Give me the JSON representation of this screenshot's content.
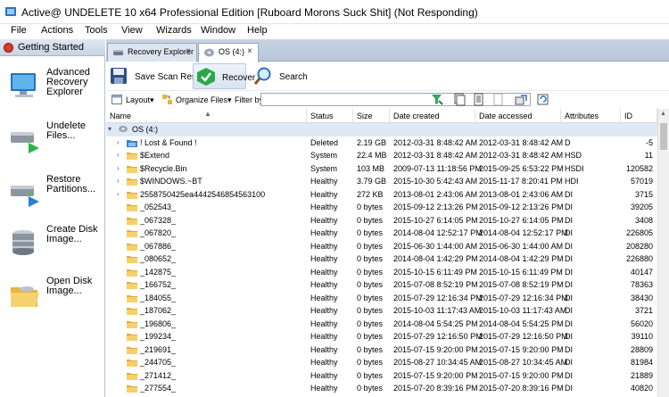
{
  "window": {
    "title": "Active@ UNDELETE 10 x64 Professional Edition [Ruboard Morons Suck Shit] (Not Responding)"
  },
  "menu": [
    "File",
    "Actions",
    "Tools",
    "View",
    "Wizards",
    "Window",
    "Help"
  ],
  "left_panel": {
    "header": "Getting Started",
    "items": [
      {
        "label": "Advanced\nRecovery\nExplorer",
        "icon": "computer-icon"
      },
      {
        "label": "Undelete\nFiles...",
        "icon": "disk-undelete-icon"
      },
      {
        "label": "Restore\nPartitions...",
        "icon": "disk-restore-icon"
      },
      {
        "label": "Create Disk\nImage...",
        "icon": "disk-stack-icon"
      },
      {
        "label": "Open Disk\nImage...",
        "icon": "open-folder-icon"
      }
    ]
  },
  "tabs": [
    {
      "label": "Recovery Explorer",
      "icon": "drive-icon",
      "close": "×"
    },
    {
      "label": "OS (4:)",
      "icon": "disk-icon",
      "close": "×"
    }
  ],
  "toolbar": {
    "save_scan": "Save Scan Results",
    "recover": "Recover",
    "search": "Search"
  },
  "filterbar": {
    "layout": "Layout▾",
    "organize": "Organize Files▾",
    "filter_by": "Filter by:",
    "filter_value": ""
  },
  "columns": [
    "Name",
    "Status",
    "Size",
    "Date created",
    "Date accessed",
    "Attributes",
    "ID"
  ],
  "drive_row": {
    "name": "OS (4:)"
  },
  "rows": [
    {
      "name": "! Lost & Found !",
      "status": "Deleted",
      "size": "2.19 GB",
      "created": "2012-03-31 8:48:42 AM",
      "accessed": "2012-03-31 8:48:42 AM",
      "attr": "D",
      "id": "-5",
      "type": "lost"
    },
    {
      "name": "$Extend",
      "status": "System",
      "size": "22.4 MB",
      "created": "2012-03-31 8:48:42 AM",
      "accessed": "2012-03-31 8:48:42 AM",
      "attr": "HSD",
      "id": "11",
      "type": "folder"
    },
    {
      "name": "$Recycle.Bin",
      "status": "System",
      "size": "103 MB",
      "created": "2009-07-13 11:18:56 PM",
      "accessed": "2015-09-25 6:53:22 PM",
      "attr": "HSDI",
      "id": "120582",
      "type": "folder"
    },
    {
      "name": "$WINDOWS.~BT",
      "status": "Healthy",
      "size": "3.79 GB",
      "created": "2015-10-30 5:42:43 AM",
      "accessed": "2015-11-17 8:20:41 PM",
      "attr": "HDI",
      "id": "57019",
      "type": "folder"
    },
    {
      "name": "2558750425ea4442546854563100",
      "status": "Healthy",
      "size": "272 KB",
      "created": "2013-08-01 2:43:06 AM",
      "accessed": "2013-08-01 2:43:06 AM",
      "attr": "DI",
      "id": "3715",
      "type": "folder"
    },
    {
      "name": "_052543_",
      "status": "Healthy",
      "size": "0 bytes",
      "created": "2015-09-12 2:13:26 PM",
      "accessed": "2015-09-12 2:13:26 PM",
      "attr": "DI",
      "id": "39205",
      "type": "folder"
    },
    {
      "name": "_067328_",
      "status": "Healthy",
      "size": "0 bytes",
      "created": "2015-10-27 6:14:05 PM",
      "accessed": "2015-10-27 6:14:05 PM",
      "attr": "DI",
      "id": "3408",
      "type": "folder"
    },
    {
      "name": "_067820_",
      "status": "Healthy",
      "size": "0 bytes",
      "created": "2014-08-04 12:52:17 PM",
      "accessed": "2014-08-04 12:52:17 PM",
      "attr": "DI",
      "id": "226805",
      "type": "folder"
    },
    {
      "name": "_067886_",
      "status": "Healthy",
      "size": "0 bytes",
      "created": "2015-06-30 1:44:00 AM",
      "accessed": "2015-06-30 1:44:00 AM",
      "attr": "DI",
      "id": "208280",
      "type": "folder"
    },
    {
      "name": "_080652_",
      "status": "Healthy",
      "size": "0 bytes",
      "created": "2014-08-04 1:42:29 PM",
      "accessed": "2014-08-04 1:42:29 PM",
      "attr": "DI",
      "id": "226880",
      "type": "folder"
    },
    {
      "name": "_142875_",
      "status": "Healthy",
      "size": "0 bytes",
      "created": "2015-10-15 6:11:49 PM",
      "accessed": "2015-10-15 6:11:49 PM",
      "attr": "DI",
      "id": "40147",
      "type": "folder"
    },
    {
      "name": "_166752_",
      "status": "Healthy",
      "size": "0 bytes",
      "created": "2015-07-08 8:52:19 PM",
      "accessed": "2015-07-08 8:52:19 PM",
      "attr": "DI",
      "id": "78363",
      "type": "folder"
    },
    {
      "name": "_184055_",
      "status": "Healthy",
      "size": "0 bytes",
      "created": "2015-07-29 12:16:34 PM",
      "accessed": "2015-07-29 12:16:34 PM",
      "attr": "DI",
      "id": "38430",
      "type": "folder"
    },
    {
      "name": "_187062_",
      "status": "Healthy",
      "size": "0 bytes",
      "created": "2015-10-03 11:17:43 AM",
      "accessed": "2015-10-03 11:17:43 AM",
      "attr": "DI",
      "id": "3721",
      "type": "folder"
    },
    {
      "name": "_196806_",
      "status": "Healthy",
      "size": "0 bytes",
      "created": "2014-08-04 5:54:25 PM",
      "accessed": "2014-08-04 5:54:25 PM",
      "attr": "DI",
      "id": "56020",
      "type": "folder"
    },
    {
      "name": "_199234_",
      "status": "Healthy",
      "size": "0 bytes",
      "created": "2015-07-29 12:16:50 PM",
      "accessed": "2015-07-29 12:16:50 PM",
      "attr": "DI",
      "id": "39110",
      "type": "folder"
    },
    {
      "name": "_219691_",
      "status": "Healthy",
      "size": "0 bytes",
      "created": "2015-07-15 9:20:00 PM",
      "accessed": "2015-07-15 9:20:00 PM",
      "attr": "DI",
      "id": "28809",
      "type": "folder"
    },
    {
      "name": "_244705_",
      "status": "Healthy",
      "size": "0 bytes",
      "created": "2015-08-27 10:34:45 AM",
      "accessed": "2015-08-27 10:34:45 AM",
      "attr": "DI",
      "id": "81984",
      "type": "folder"
    },
    {
      "name": "_271412_",
      "status": "Healthy",
      "size": "0 bytes",
      "created": "2015-07-15 9:20:00 PM",
      "accessed": "2015-07-15 9:20:00 PM",
      "attr": "DI",
      "id": "21889",
      "type": "folder"
    },
    {
      "name": "_277554_",
      "status": "Healthy",
      "size": "0 bytes",
      "created": "2015-07-20 8:39:16 PM",
      "accessed": "2015-07-20 8:39:16 PM",
      "attr": "DI",
      "id": "40820",
      "type": "folder"
    }
  ]
}
